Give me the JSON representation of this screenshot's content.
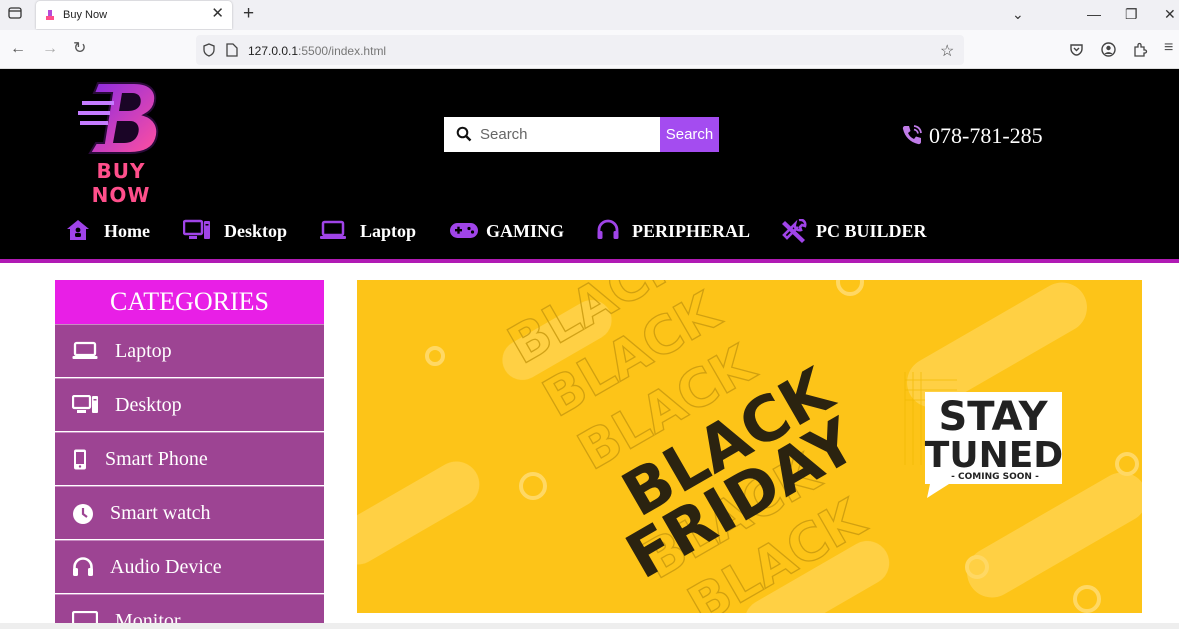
{
  "browser": {
    "tab_title": "Buy Now",
    "url_host": "127.0.0.1",
    "url_path": ":5500/index.html"
  },
  "site": {
    "logo_text": "BUY NOW",
    "search": {
      "placeholder": "Search",
      "button_label": "Search"
    },
    "phone": "078-781-285",
    "menu": [
      {
        "label": "Home",
        "icon": "home-icon"
      },
      {
        "label": "Desktop",
        "icon": "desktop-icon"
      },
      {
        "label": "Laptop",
        "icon": "laptop-icon"
      },
      {
        "label": "GAMING",
        "icon": "gamepad-icon"
      },
      {
        "label": "PERIPHERAL",
        "icon": "headphones-icon"
      },
      {
        "label": "PC BUILDER",
        "icon": "tools-icon"
      }
    ],
    "categories": {
      "title": "CATEGORIES",
      "items": [
        {
          "label": "Laptop",
          "icon": "laptop-icon"
        },
        {
          "label": "Desktop",
          "icon": "desktop-icon"
        },
        {
          "label": "Smart Phone",
          "icon": "phone-icon"
        },
        {
          "label": "Smart watch",
          "icon": "clock-icon"
        },
        {
          "label": "Audio Device",
          "icon": "headphones-icon"
        },
        {
          "label": "Monitor",
          "icon": "monitor-icon"
        }
      ]
    },
    "banner": {
      "main_line1": "BLACK",
      "main_line2": "FRIDAY",
      "bg_word": "BLACK",
      "badge_line1": "STAY",
      "badge_line2": "TUNED",
      "badge_line3": "- COMING SOON -"
    }
  },
  "colors": {
    "header_bg": "#000000",
    "accent_purple": "#a44cf0",
    "category_header": "#e81fe6",
    "category_item": "#9d4493",
    "banner_yellow": "#fdc418",
    "logo_pink": "#ff4f8b"
  }
}
